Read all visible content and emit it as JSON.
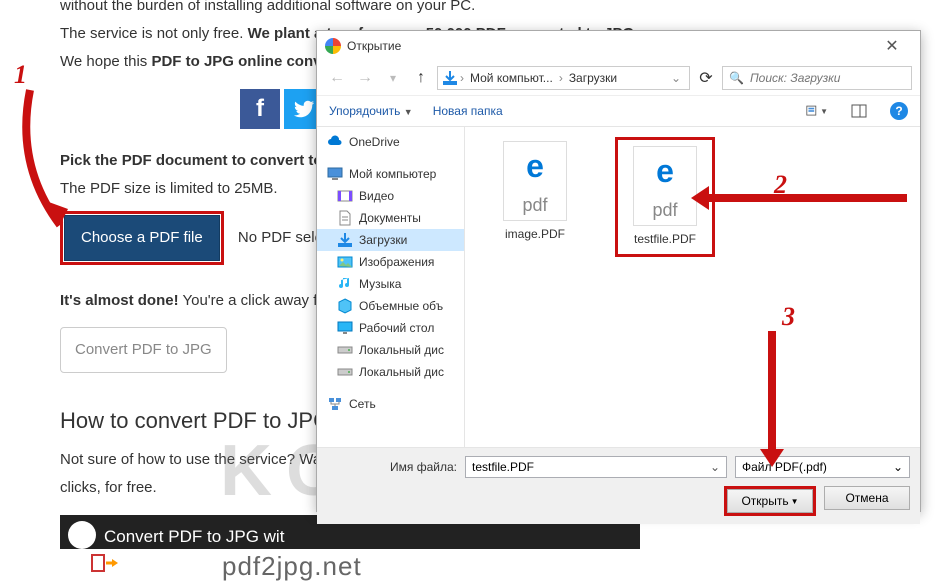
{
  "page": {
    "line1_pre": "without the burden of installing additional software on your PC.",
    "line2_pre": "The service is not only free. ",
    "line2_bold": "We plant a tree for every 50,000 PDF converted to JPG.",
    "line3_pre": "We hope this ",
    "line3_bold": "PDF to JPG online conve",
    "pick_bold": "Pick the PDF document to convert to J",
    "pick_sub": "The PDF size is limited to 25MB.",
    "choose_label": "Choose a PDF file",
    "no_pdf": "No PDF selected",
    "almost_bold": "It's almost done!",
    "almost_rest": " You're a click away fro",
    "convert_label": "Convert PDF to JPG",
    "howto": "How to convert PDF to JPG",
    "notsure": "Not sure of how to use the service? Wat",
    "notsure2": "clicks, for free.",
    "video_title": "Convert PDF to JPG wit",
    "video_text": "pdf2jpg.net"
  },
  "dialog": {
    "title": "Открытие",
    "path_root": "Мой компьют...",
    "path_cur": "Загрузки",
    "search_placeholder": "Поиск: Загрузки",
    "organize": "Упорядочить",
    "newfolder": "Новая папка",
    "tree": {
      "onedrive": "OneDrive",
      "mycomputer": "Мой компьютер",
      "video": "Видео",
      "documents": "Документы",
      "downloads": "Загрузки",
      "images": "Изображения",
      "music": "Музыка",
      "volumes": "Объемные объ",
      "desktop": "Рабочий стол",
      "localdisk1": "Локальный дис",
      "localdisk2": "Локальный дис",
      "network": "Сеть"
    },
    "files": [
      {
        "name": "image.PDF",
        "ext": "pdf"
      },
      {
        "name": "testfile.PDF",
        "ext": "pdf"
      }
    ],
    "filename_label": "Имя файла:",
    "filename_value": "testfile.PDF",
    "filetype": "Файл PDF(.pdf)",
    "open": "Открыть",
    "cancel": "Отмена"
  },
  "annotations": {
    "a1": "1",
    "a2": "2",
    "a3": "3"
  },
  "watermark": "KONEKTO.RU"
}
